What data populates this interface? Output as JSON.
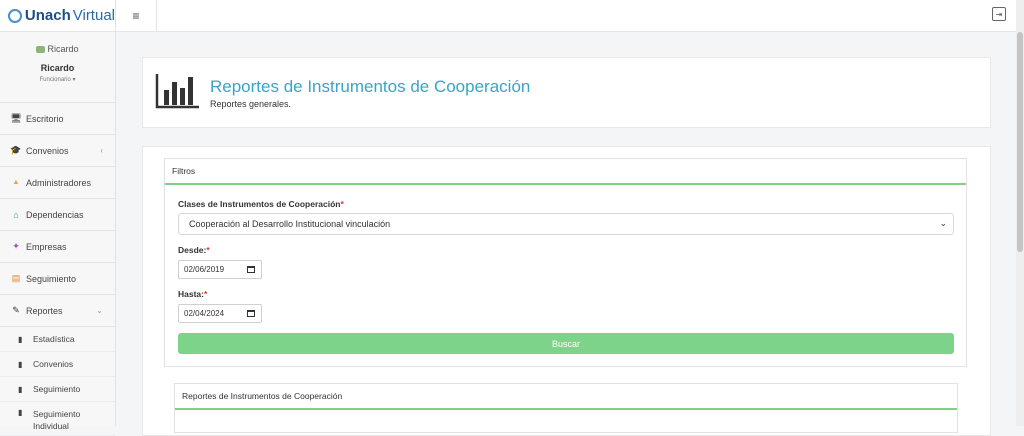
{
  "brand": {
    "bold": "Unach",
    "rest": "Virtual"
  },
  "user": {
    "photo_alt": "Ricardo",
    "name": "Ricardo",
    "role": "Funcionario ▾"
  },
  "nav": [
    {
      "label": "Escritorio",
      "icon": "monitor-icon",
      "glyph": "🖥",
      "color": "#444"
    },
    {
      "label": "Convenios",
      "icon": "graduation-cap-icon",
      "glyph": "🎓",
      "color": "#2f7fc0",
      "chevron": "‹"
    },
    {
      "label": "Administradores",
      "icon": "user-icon",
      "glyph": "▲",
      "color": "#f0a020"
    },
    {
      "label": "Dependencias",
      "icon": "bank-icon",
      "glyph": "⌂",
      "color": "#3aa057"
    },
    {
      "label": "Empresas",
      "icon": "users-icon",
      "glyph": "✦",
      "color": "#9a50c8"
    },
    {
      "label": "Seguimiento",
      "icon": "calendar-icon",
      "glyph": "▤",
      "color": "#e88030"
    },
    {
      "label": "Reportes",
      "icon": "pencil-icon",
      "glyph": "✎",
      "color": "#333",
      "chevron": "⌄"
    }
  ],
  "subnav": [
    {
      "label": "Estadística"
    },
    {
      "label": "Convenios"
    },
    {
      "label": "Seguimiento"
    },
    {
      "label": "Seguimiento Individual"
    }
  ],
  "topbar": {
    "menu_glyph": "≡",
    "logout_glyph": "⇥"
  },
  "header": {
    "title": "Reportes de Instrumentos de Cooperación",
    "subtitle": "Reportes generales."
  },
  "filters": {
    "heading": "Filtros",
    "clases_label": "Clases de Instrumentos de Cooperación",
    "clases_value": "Cooperación al Desarrollo Institucional vinculación",
    "desde_label": "Desde:",
    "desde_value": "02/06/2019",
    "hasta_label": "Hasta:",
    "hasta_value": "02/04/2024",
    "required_mark": "*",
    "search_button": "Buscar"
  },
  "report": {
    "heading": "Reportes de Instrumentos de Cooperación"
  },
  "colors": {
    "accent": "#3ba3c9",
    "button": "#7dd38a",
    "required": "#d9342b"
  }
}
